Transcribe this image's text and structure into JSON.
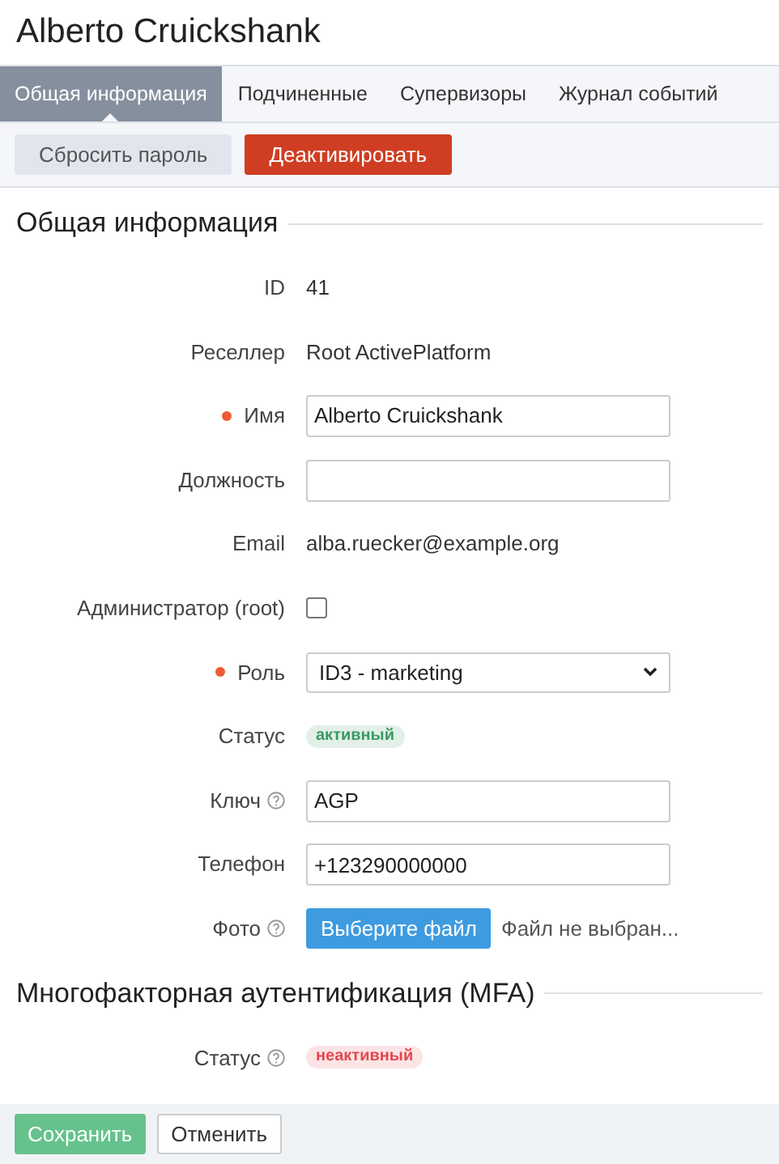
{
  "title": "Alberto Cruickshank",
  "tabs": [
    {
      "label": "Общая информация",
      "selected": true
    },
    {
      "label": "Подчиненные",
      "selected": false
    },
    {
      "label": "Супервизоры",
      "selected": false
    },
    {
      "label": "Журнал событий",
      "selected": false
    }
  ],
  "toolbar": [
    {
      "label": "Сбросить пароль",
      "kind": "secondary"
    },
    {
      "label": "Деактивировать",
      "kind": "danger"
    }
  ],
  "sections": [
    {
      "title": "Общая информация",
      "fields": [
        {
          "label": "ID",
          "kind": "text",
          "value": "41"
        },
        {
          "label": "Реселлер",
          "kind": "text",
          "value": "Root ActivePlatform"
        },
        {
          "label": "Имя",
          "kind": "input",
          "required": true,
          "value": "Alberto Cruickshank"
        },
        {
          "label": "Должность",
          "kind": "input"
        },
        {
          "label": "Email",
          "kind": "text",
          "value": "alba.ruecker@example.org"
        },
        {
          "label": "Администратор (root)",
          "kind": "checkbox",
          "checked": false
        },
        {
          "label": "Роль",
          "kind": "select",
          "required": true,
          "value": "ID3 - marketing"
        },
        {
          "label": "Статус",
          "kind": "badge",
          "color": "#3a9a62",
          "value": "активный"
        },
        {
          "label": "Ключ",
          "kind": "input",
          "help": true,
          "value": "AGP"
        },
        {
          "label": "Телефон",
          "kind": "input",
          "value": "+123290000000"
        },
        {
          "label": "Фото",
          "kind": "file",
          "help": true,
          "button": "Выберите файл",
          "value": "Файл не выбран..."
        }
      ]
    },
    {
      "title": "Многофакторная аутентификация (MFA)",
      "fields": [
        {
          "label": "Статус",
          "kind": "badge",
          "color": "#e4484f",
          "help": true,
          "value": "неактивный"
        }
      ]
    }
  ],
  "footer": [
    {
      "label": "Сохранить",
      "kind": "primary"
    },
    {
      "label": "Отменить",
      "kind": "outline"
    }
  ]
}
